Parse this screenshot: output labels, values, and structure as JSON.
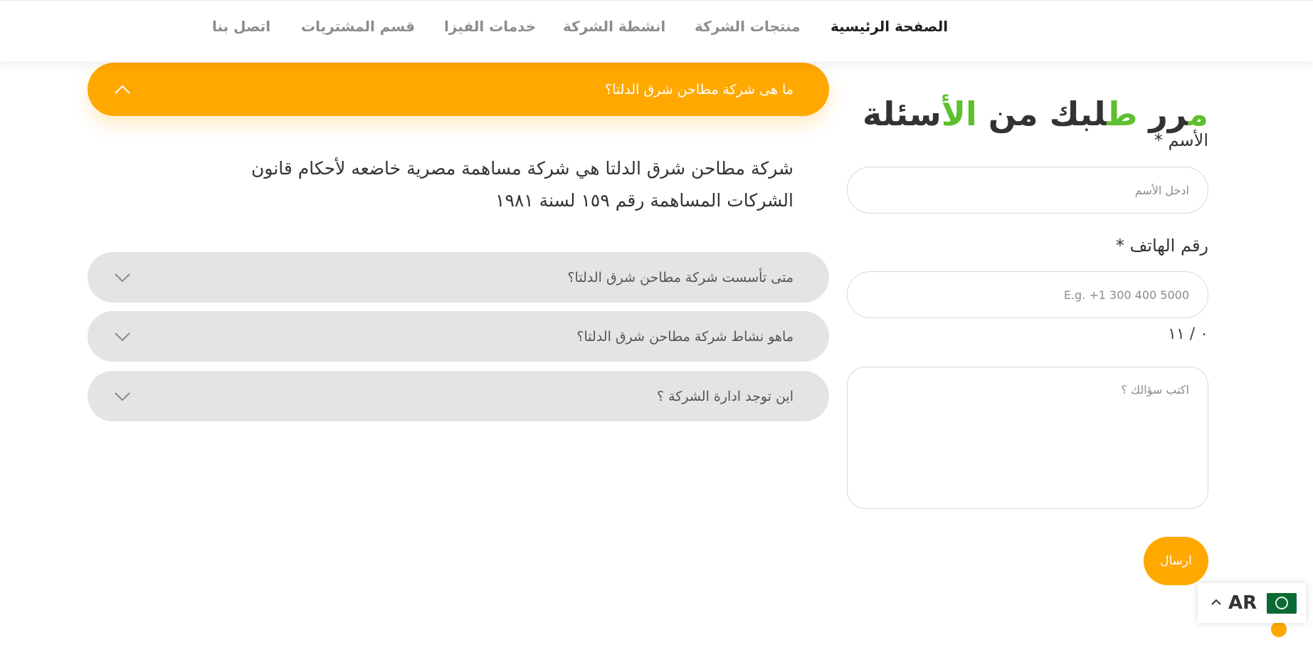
{
  "nav": {
    "items": [
      {
        "label": "الصفحة الرئيسية",
        "active": true
      },
      {
        "label": "منتجات الشركة",
        "active": false
      },
      {
        "label": "انشطة الشركة",
        "active": false
      },
      {
        "label": "خدمات الفيزا",
        "active": false
      },
      {
        "label": "قسم المشتريات",
        "active": false
      },
      {
        "label": "اتصل بنا",
        "active": false
      }
    ]
  },
  "form": {
    "title_parts": [
      "م",
      "ر",
      "ر ",
      "ط",
      "لبك من ",
      "ال",
      "أسئلة"
    ],
    "name_label": "الأسم *",
    "name_placeholder": "ادخل الأسم",
    "phone_label": "رقم الهاتف *",
    "phone_placeholder": "E.g. +1 300 400 5000",
    "counter": "٠ / ١١",
    "question_placeholder": "اكتب سؤالك ؟",
    "submit_label": "ارسال"
  },
  "faq": {
    "items": [
      {
        "question": "ما هى شركة مطاحن شرق الدلتا؟",
        "open": true,
        "answer": "شركة مطاحن شرق الدلتا هي شركة مساهمة مصرية خاضعه لأحكام قانون الشركات المساهمة رقم ١٥٩ لسنة ١٩٨١"
      },
      {
        "question": "متى تأسست شركة مطاحن شرق الدلتا؟",
        "open": false
      },
      {
        "question": "ماهو نشاط شركة مطاحن شرق الدلتا؟",
        "open": false
      },
      {
        "question": "اين توجد ادارة الشركة ؟",
        "open": false
      }
    ]
  },
  "language": {
    "code": "AR",
    "flag_icon": "arab-league-flag-icon"
  },
  "colors": {
    "accent": "#ffa800",
    "green": "#5fbf2e",
    "text_dark": "#333333",
    "closed_panel": "#e4e4e4"
  }
}
